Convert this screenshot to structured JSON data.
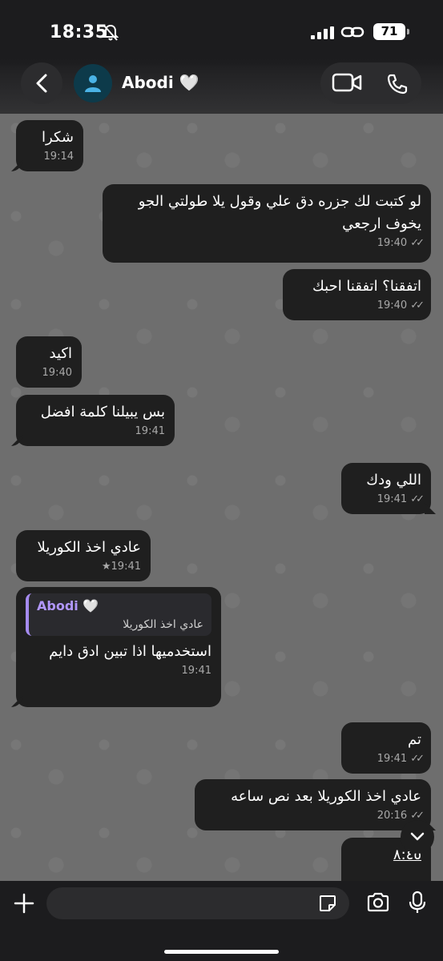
{
  "status": {
    "time": "18:35",
    "battery": "71"
  },
  "header": {
    "contact_name": "Abodi 🤍"
  },
  "messages": [
    {
      "text": "شكرا",
      "time": "19:14",
      "ticks": ""
    },
    {
      "text": "لو كتبت لك جزره دق علي وقول يلا طولتي الجو يخوف ارجعي",
      "time": "19:40",
      "ticks": "✓✓"
    },
    {
      "text": "اتفقنا؟ اتفقنا احبك",
      "time": "19:40",
      "ticks": "✓✓"
    },
    {
      "text": "اكيد",
      "time": "19:40",
      "ticks": ""
    },
    {
      "text": "بس يبيلنا كلمة افضل",
      "time": "19:41",
      "ticks": ""
    },
    {
      "text": "اللي ودك",
      "time": "19:41",
      "ticks": "✓✓"
    },
    {
      "text": "عادي اخذ الكوريلا",
      "time": "★19:41",
      "ticks": ""
    },
    {
      "text": "استخدميها اذا تبين ادق دايم",
      "time": "19:41",
      "ticks": "",
      "reply_name": "Abodi 🤍",
      "reply_text": "عادي اخذ الكوريلا"
    },
    {
      "text": "تم",
      "time": "19:41",
      "ticks": "✓✓"
    },
    {
      "text": "عادي اخذ الكوريلا بعد نص ساعه",
      "time": "20:16",
      "ticks": "✓✓"
    },
    {
      "text": "٨:٤٥",
      "time": "",
      "ticks": ""
    }
  ],
  "composer": {
    "placeholder": ""
  }
}
